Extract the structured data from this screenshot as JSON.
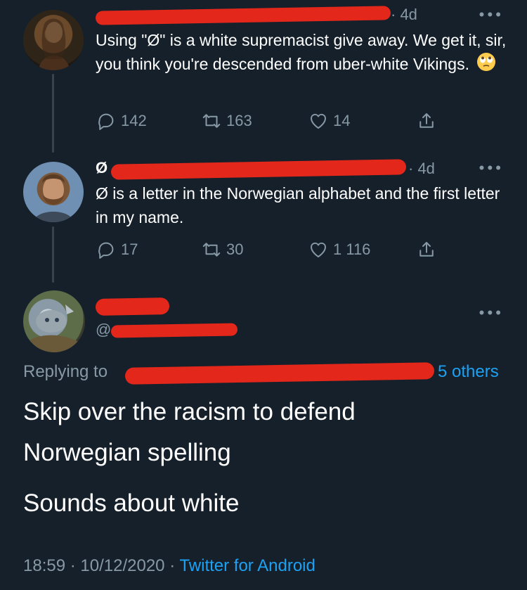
{
  "tweet1": {
    "header_visible": "· 4d",
    "text": "Using \"Ø\" is a white supremacist give away.  We get it, sir, you think you're descended from uber-white Vikings.",
    "emoji": "face-with-rolling-eyes",
    "replies": "142",
    "retweets": "163",
    "likes": "14"
  },
  "tweet2": {
    "name_partial": "Ø",
    "header_visible": "· 4d",
    "text": "Ø is a letter in the Norwegian alphabet and the first letter in my name.",
    "replies": "17",
    "retweets": "30",
    "likes": "1 116"
  },
  "tweet3": {
    "handle_prefix": "@",
    "replying_to_label": "Replying to",
    "replying_to_suffix": "5 others",
    "line1": "Skip over the racism to defend",
    "line2": "Norwegian spelling",
    "line3": "Sounds about white",
    "time": "18:59",
    "date": "10/12/2020",
    "source": "Twitter for Android"
  },
  "icons": {
    "more": "more-horizontal-icon",
    "reply": "reply-icon",
    "retweet": "retweet-icon",
    "like": "heart-icon",
    "share": "share-icon"
  },
  "colors": {
    "background": "#15202b",
    "muted": "#8899a6",
    "accent": "#1da1f2",
    "redaction": "#e3271b"
  }
}
